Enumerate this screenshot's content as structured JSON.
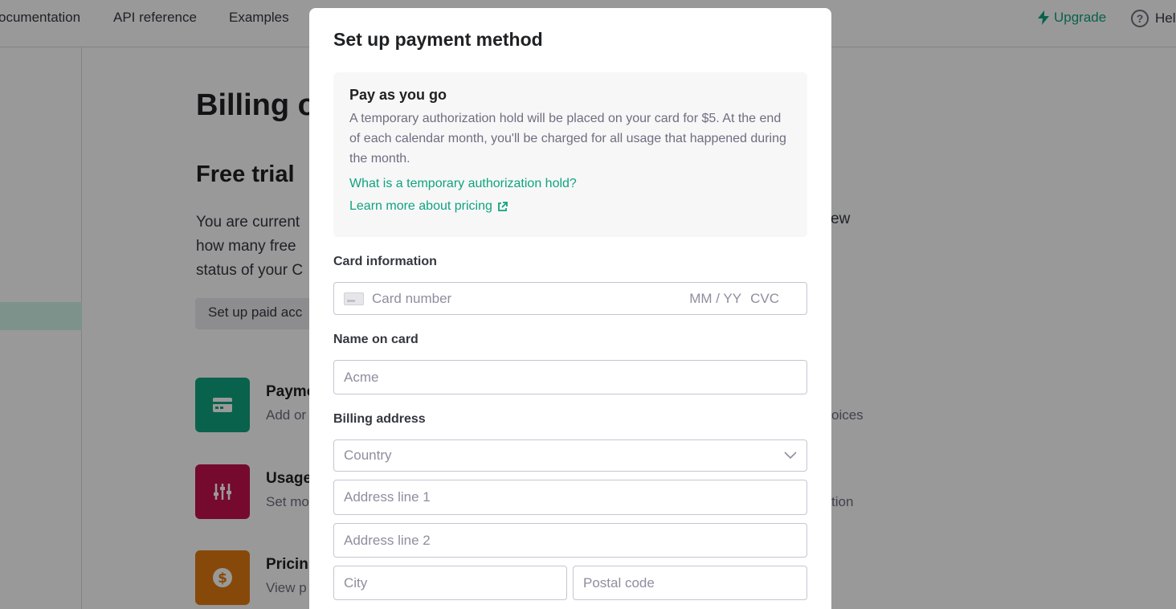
{
  "nav": {
    "links": [
      "ocumentation",
      "API reference",
      "Examples"
    ],
    "upgrade_label": "Upgrade",
    "help_label": "Hel"
  },
  "page": {
    "title": "Billing o",
    "section_title": "Free trial",
    "para_lines": [
      "You are current",
      "how many free",
      "status of your C"
    ],
    "para_right": "ew",
    "setup_button": "Set up paid acc",
    "tiles": [
      {
        "title": "Payme",
        "desc": "Add or",
        "desc_right": "oices",
        "color": "#10a37f",
        "icon": "credit-card-icon"
      },
      {
        "title": "Usage",
        "desc": "Set mo",
        "desc_right": "tion",
        "color": "#c3124e",
        "icon": "sliders-icon"
      },
      {
        "title": "Pricin",
        "desc": "View p",
        "desc_right": "",
        "color": "#e27a10",
        "icon": "dollar-icon"
      }
    ]
  },
  "modal": {
    "title": "Set up payment method",
    "info": {
      "title": "Pay as you go",
      "text": "A temporary authorization hold will be placed on your card for $5. At the end of each calendar month, you'll be charged for all usage that happened during the month.",
      "link1": "What is a temporary authorization hold?",
      "link2": "Learn more about pricing"
    },
    "card_label": "Card information",
    "card_number_placeholder": "Card number",
    "expiry_placeholder": "MM / YY",
    "cvc_placeholder": "CVC",
    "name_label": "Name on card",
    "name_placeholder": "Acme",
    "billing_label": "Billing address",
    "country_placeholder": "Country",
    "address1_placeholder": "Address line 1",
    "address2_placeholder": "Address line 2",
    "city_placeholder": "City",
    "postal_placeholder": "Postal code"
  },
  "colors": {
    "accent": "#10a37f"
  }
}
